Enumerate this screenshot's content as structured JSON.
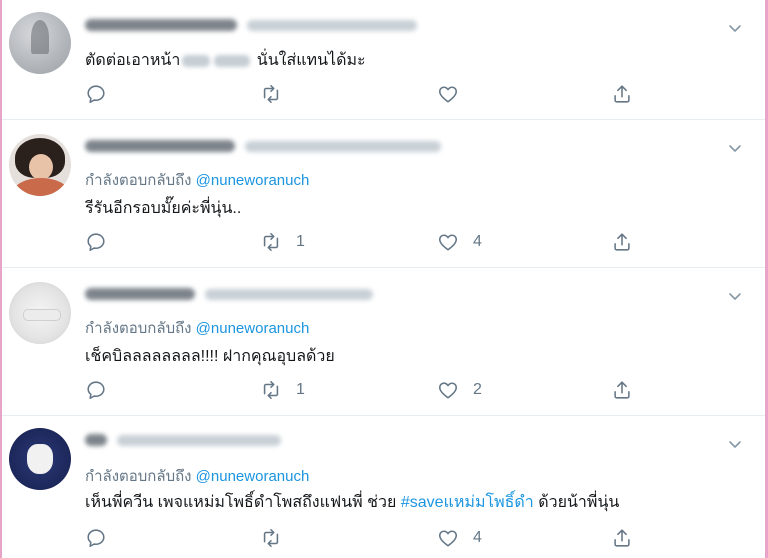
{
  "tweets": [
    {
      "body_prefix": "ตัดต่อเอาหน้า",
      "body_suffix": "นั่นใส่แทนได้มะ",
      "replies": "",
      "retweets": "",
      "likes": ""
    },
    {
      "reply_label": "กำลังตอบกลับถึง",
      "reply_handle": "@nuneworanuch",
      "body": "รีรันอีกรอบมั๊ยค่ะพี่นุ่น..",
      "replies": "",
      "retweets": "1",
      "likes": "4"
    },
    {
      "reply_label": "กำลังตอบกลับถึง",
      "reply_handle": "@nuneworanuch",
      "body": "เช็คบิลลลลลลลล!!!! ฝากคุณอุบลด้วย",
      "replies": "",
      "retweets": "1",
      "likes": "2"
    },
    {
      "reply_label": "กำลังตอบกลับถึง",
      "reply_handle": "@nuneworanuch",
      "body_prefix": "เห็นพี่ควีน เพจแหม่มโพธิ์ดำโพสถึงแฟนพี่ ช่วย ",
      "hashtag": "#saveแหม่มโพธิ์ดำ",
      "body_suffix": " ด้วยน้าพี่นุ่น",
      "replies": "",
      "retweets": "",
      "likes": "4"
    }
  ],
  "icons": {
    "reply": "reply-icon",
    "retweet": "retweet-icon",
    "like": "heart-icon",
    "share": "share-icon",
    "more": "chevron-down-icon"
  },
  "colors": {
    "text": "#14171a",
    "secondary": "#657786",
    "link": "#1b95e0",
    "divider": "#e6ecf0",
    "frame": "#e8a3c8"
  }
}
